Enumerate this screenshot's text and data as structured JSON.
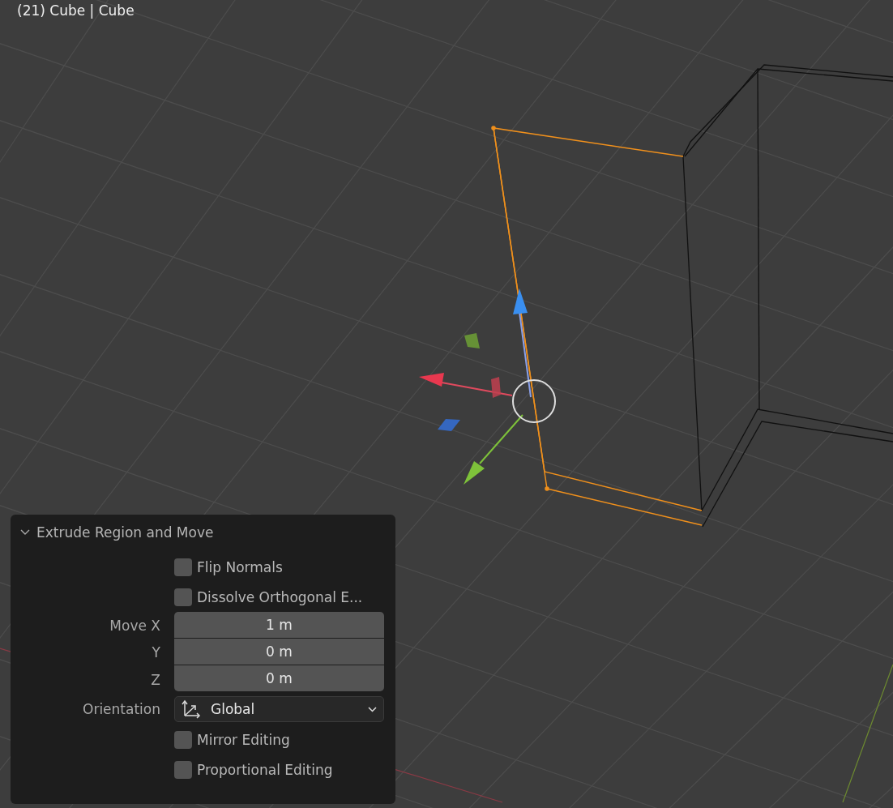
{
  "viewport": {
    "title": "(21) Cube | Cube"
  },
  "panel": {
    "title": "Extrude Region and Move",
    "expanded": true,
    "rows": [
      {
        "kind": "checkbox",
        "label": "Flip Normals",
        "checked": false
      },
      {
        "kind": "checkbox",
        "label": "Dissolve Orthogonal E...",
        "checked": false
      },
      {
        "kind": "number",
        "label": "Move X",
        "value": "1 m"
      },
      {
        "kind": "number",
        "label": "Y",
        "value": "0 m"
      },
      {
        "kind": "number",
        "label": "Z",
        "value": "0 m"
      },
      {
        "kind": "dropdown",
        "label": "Orientation",
        "value": "Global"
      },
      {
        "kind": "checkbox",
        "label": "Mirror Editing",
        "checked": false
      },
      {
        "kind": "checkbox",
        "label": "Proportional Editing",
        "checked": false
      }
    ]
  }
}
